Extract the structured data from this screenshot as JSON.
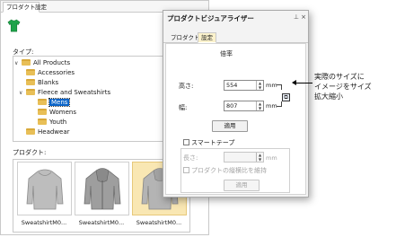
{
  "left_panel": {
    "tabs": [
      "プロダクト",
      "設定"
    ],
    "type_label": "タイプ:",
    "tree": [
      {
        "label": "All Products",
        "level": 0,
        "chevron": "v"
      },
      {
        "label": "Accessories",
        "level": 1
      },
      {
        "label": "Blanks",
        "level": 1
      },
      {
        "label": "Fleece and Sweatshirts",
        "level": 1,
        "chevron": "v"
      },
      {
        "label": "Mens",
        "level": 2,
        "selected": true
      },
      {
        "label": "Womens",
        "level": 2
      },
      {
        "label": "Youth",
        "level": 2
      },
      {
        "label": "Headwear",
        "level": 1
      }
    ],
    "products_label": "プロダクト:",
    "products": [
      {
        "label": "SweatshirtM0...",
        "style": "pullover",
        "selected": false
      },
      {
        "label": "SweatshirtM0...",
        "style": "zip",
        "selected": false
      },
      {
        "label": "SweatshirtM0...",
        "style": "pullover",
        "selected": true
      }
    ]
  },
  "visualizer": {
    "title": "プロダクトビジュアライザー",
    "pin": "⊥",
    "close": "×",
    "tabs": [
      "プロダクト",
      "設定"
    ],
    "scale_heading": "倍率",
    "height_label": "高さ:",
    "height_value": "554",
    "width_label": "幅:",
    "width_value": "807",
    "unit": "mm",
    "apply_label": "適用",
    "smart_tape_label": "スマートテープ",
    "length_label": "長さ:",
    "length_unit": "mm",
    "keep_ratio_label": "プロダクトの縦横比を維持",
    "apply2_label": "適用"
  },
  "callout": {
    "line1": "実際のサイズに",
    "line2": "イメージをサイズ",
    "line3": "拡大縮小"
  },
  "colors": {
    "selection": "#0a64c8",
    "selected_card": "#f9e7b3",
    "active_tab": "#fbf2cc",
    "shirt_icon": "#1ea34a",
    "folder": "#e8bf57"
  }
}
